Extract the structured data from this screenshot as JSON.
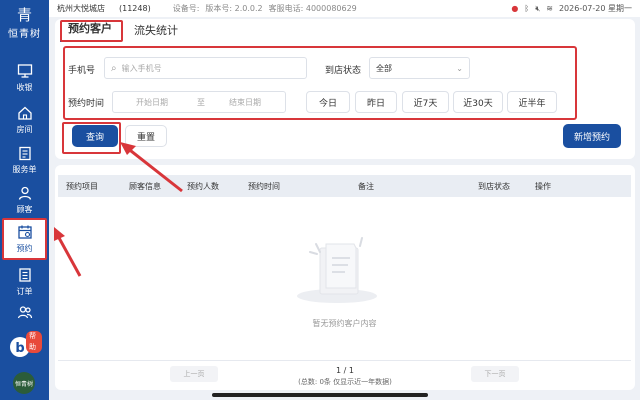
{
  "sidebar": {
    "logo": {
      "mark": "青",
      "name": "恒青树"
    },
    "items": [
      {
        "label": "收银",
        "icon": "monitor-icon"
      },
      {
        "label": "房间",
        "icon": "home-icon"
      },
      {
        "label": "服务单",
        "icon": "clipboard-icon"
      },
      {
        "label": "顾客",
        "icon": "user-icon"
      },
      {
        "label": "预约",
        "icon": "calendar-icon",
        "active": true
      },
      {
        "label": "订单",
        "icon": "list-icon"
      },
      {
        "label": "",
        "icon": "users-icon"
      }
    ],
    "help_badge": "帮助",
    "bottom_logo": "恒青树"
  },
  "status": {
    "store": "杭州大悦城店",
    "store_id": "(11248)",
    "device_label": "设备号:",
    "version_label": "版本号: 2.0.0.2",
    "phone_label": "客服电话: 4000080629",
    "datetime": "2026-07-20 星期一"
  },
  "tabs": [
    {
      "label": "预约客户",
      "active": true
    },
    {
      "label": "流失统计",
      "active": false
    }
  ],
  "filters": {
    "phone_label": "手机号",
    "phone_placeholder": "输入手机号",
    "status_label": "到店状态",
    "status_value": "全部",
    "time_label": "预约时间",
    "start_placeholder": "开始日期",
    "to": "至",
    "end_placeholder": "结束日期",
    "quick": [
      "今日",
      "昨日",
      "近7天",
      "近30天",
      "近半年"
    ]
  },
  "actions": {
    "query": "查询",
    "reset": "重置",
    "add": "新增预约"
  },
  "table": {
    "columns": [
      "预约项目",
      "顾客信息",
      "预约人数",
      "预约时间",
      "备注",
      "到店状态",
      "操作"
    ],
    "empty_text": "暂无预约客户内容"
  },
  "pagination": {
    "prev": "上一页",
    "next": "下一页",
    "page": "1 / 1",
    "summary": "(总数: 0条 仅显示近一年数据)"
  },
  "colors": {
    "primary": "#1a4fa0",
    "highlight": "#d8363a"
  }
}
